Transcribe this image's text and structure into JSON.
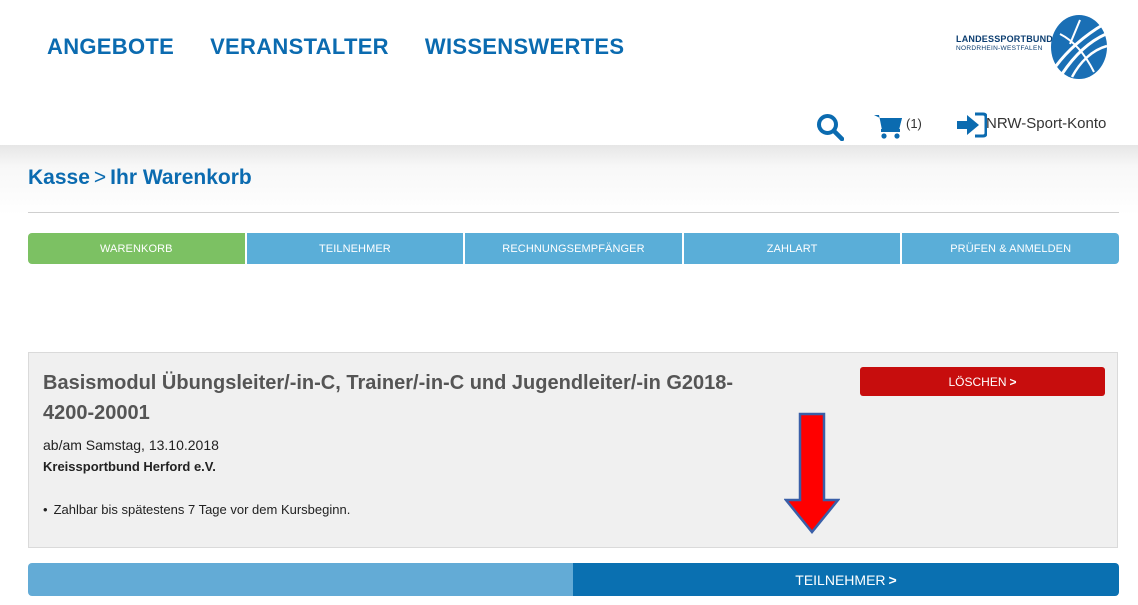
{
  "nav": {
    "items": [
      "ANGEBOTE",
      "VERANSTALTER",
      "WISSENSWERTES"
    ]
  },
  "logo": {
    "line1": "LANDESSPORTBUND",
    "line2": "NORDRHEIN-WESTFALEN"
  },
  "utility": {
    "search_icon": "search-icon",
    "cart_icon": "cart-icon",
    "cart_count": "(1)",
    "login_icon": "sign-in-icon",
    "account_label": "NRW-Sport-Konto"
  },
  "breadcrumb": {
    "first": "Kasse",
    "separator": ">",
    "current": "Ihr Warenkorb"
  },
  "steps": [
    {
      "label": "WARENKORB",
      "active": true
    },
    {
      "label": "TEILNEHMER",
      "active": false
    },
    {
      "label": "RECHNUNGSEMPFÄNGER",
      "active": false
    },
    {
      "label": "ZAHLART",
      "active": false
    },
    {
      "label": "PRÜFEN & ANMELDEN",
      "active": false
    }
  ],
  "course": {
    "title": "Basismodul Übungsleiter/-in-C, Trainer/-in-C und Jugendleiter/-in G2018-4200-20001",
    "date": "ab/am Samstag, 13.10.2018",
    "organizer": "Kreissportbund Herford e.V.",
    "note": "Zahlbar bis spätestens 7 Tage vor dem Kursbeginn.",
    "delete_label": "LÖSCHEN",
    "delete_chevron": ">"
  },
  "footer": {
    "next_label": "TEILNEHMER",
    "next_chevron": ">"
  },
  "colors": {
    "brand_blue": "#0b6bb0",
    "step_inactive": "#5aaed8",
    "step_active": "#7cc163",
    "delete_red": "#c70d0d",
    "next_blue": "#0a70b1",
    "annotation_arrow": "#ff0000"
  }
}
